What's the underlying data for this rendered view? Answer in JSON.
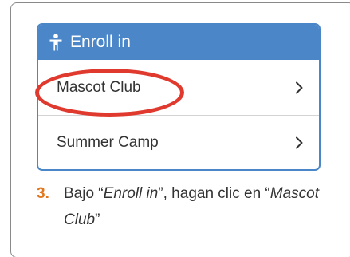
{
  "panel": {
    "title": "Enroll in",
    "header_icon": "person-icon",
    "items": [
      {
        "label": "Mascot Club",
        "icon": "chevron-right-icon"
      },
      {
        "label": "Summer Camp",
        "icon": "chevron-right-icon"
      }
    ]
  },
  "highlight": {
    "target": "Mascot Club",
    "color": "#e03a2f"
  },
  "instruction": {
    "number": "3.",
    "part1": "Bajo “",
    "em1": "Enroll in",
    "part2": "”, hagan clic en “",
    "em2": "Mascot Club",
    "part3": "”"
  },
  "colors": {
    "accent": "#4a86c8",
    "step_number": "#e2781e",
    "highlight_ring": "#e03a2f"
  }
}
